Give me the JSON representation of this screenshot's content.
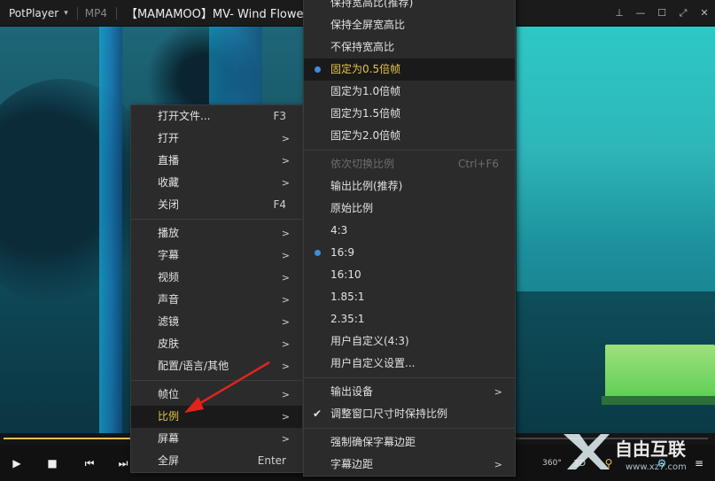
{
  "titlebar": {
    "app_name": "PotPlayer",
    "format": "MP4",
    "title": "【MAMAMOO】MV- Wind Flower"
  },
  "menu_main": {
    "items": [
      {
        "label": "打开文件...",
        "key": "F3",
        "arrow": false
      },
      {
        "label": "打开",
        "key": "",
        "arrow": true
      },
      {
        "label": "直播",
        "key": "",
        "arrow": true
      },
      {
        "label": "收藏",
        "key": "",
        "arrow": true
      },
      {
        "label": "关闭",
        "key": "F4",
        "arrow": false
      },
      {
        "label": "播放",
        "key": "",
        "arrow": true
      },
      {
        "label": "字幕",
        "key": "",
        "arrow": true
      },
      {
        "label": "视频",
        "key": "",
        "arrow": true
      },
      {
        "label": "声音",
        "key": "",
        "arrow": true
      },
      {
        "label": "滤镜",
        "key": "",
        "arrow": true
      },
      {
        "label": "皮肤",
        "key": "",
        "arrow": true
      },
      {
        "label": "配置/语言/其他",
        "key": "",
        "arrow": true
      },
      {
        "label": "帧位",
        "key": "",
        "arrow": true
      },
      {
        "label": "比例",
        "key": "",
        "arrow": true,
        "highlighted": true
      },
      {
        "label": "屏幕",
        "key": "",
        "arrow": true
      },
      {
        "label": "全屏",
        "key": "Enter",
        "arrow": false
      }
    ],
    "arrow_glyph": ">"
  },
  "menu_ratio": {
    "items": [
      {
        "label": "保持宽高比(推荐)"
      },
      {
        "label": "保持全屏宽高比"
      },
      {
        "label": "不保持宽高比"
      },
      {
        "label": "固定为0.5倍帧",
        "selected": true
      },
      {
        "label": "固定为1.0倍帧"
      },
      {
        "label": "固定为1.5倍帧"
      },
      {
        "label": "固定为2.0倍帧"
      },
      {
        "label": "依次切换比例",
        "key": "Ctrl+F6",
        "disabled": true
      },
      {
        "label": "输出比例(推荐)"
      },
      {
        "label": "原始比例"
      },
      {
        "label": "4:3"
      },
      {
        "label": "16:9",
        "selected": true
      },
      {
        "label": "16:10"
      },
      {
        "label": "1.85:1"
      },
      {
        "label": "2.35:1"
      },
      {
        "label": "用户自定义(4:3)"
      },
      {
        "label": "用户自定义设置..."
      },
      {
        "label": "输出设备",
        "arrow": true
      },
      {
        "label": "调整窗口尺寸时保持比例",
        "checked": true
      },
      {
        "label": "强制确保字幕边距"
      },
      {
        "label": "字幕边距",
        "arrow": true
      }
    ]
  },
  "controls": {
    "play_icon": "▶",
    "stop_icon": "■",
    "prev_icon": "⏮",
    "next_icon": "⏭",
    "badge_360": "360°",
    "badge_3d": "3D"
  },
  "colors": {
    "accent_gold": "#e7c34a",
    "radio_blue": "#3c8dde",
    "annotation_red": "#e0241b"
  },
  "seek": {
    "progress": 0.19
  },
  "watermark": {
    "text": "自由互联",
    "sub": "www.xz7.com"
  }
}
